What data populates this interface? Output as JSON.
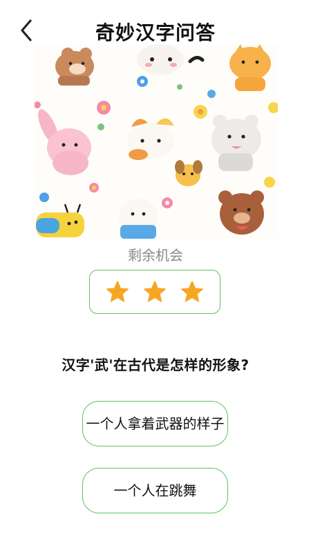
{
  "header": {
    "title": "奇妙汉字问答"
  },
  "icons": {
    "back": "chevron-left-icon",
    "star": "star-icon"
  },
  "colors": {
    "accent_green": "#5cc35c",
    "star_gold": "#f5a623"
  },
  "quiz": {
    "chances_label": "剩余机会",
    "chances_remaining": 3,
    "question": "汉字'武'在古代是怎样的形象?",
    "options": [
      {
        "label": "一个人拿着武器的样子"
      },
      {
        "label": "一个人在跳舞"
      }
    ]
  }
}
